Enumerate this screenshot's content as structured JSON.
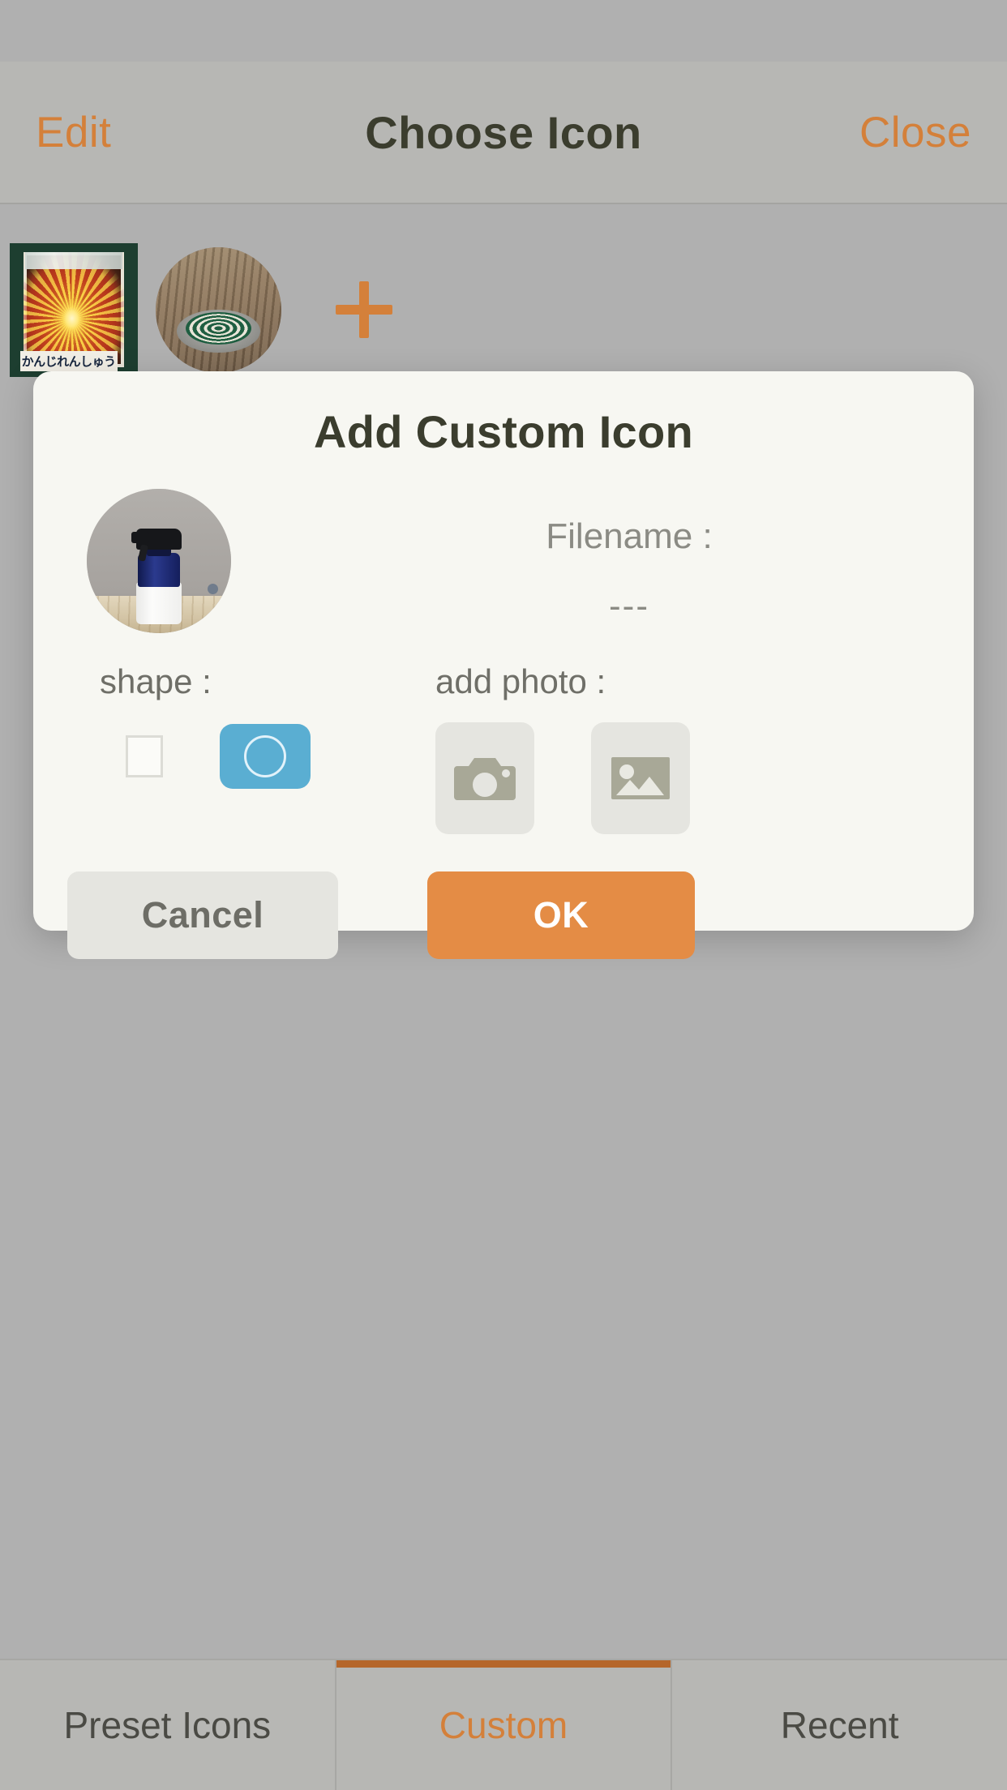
{
  "header": {
    "left_button": "Edit",
    "title": "Choose Icon",
    "right_button": "Close"
  },
  "thumbnails": {
    "items": [
      {
        "name": "seed-packet-thumbnail",
        "shape": "square",
        "caption": "かんじれんしゅう"
      },
      {
        "name": "mosquito-coil-thumbnail",
        "shape": "circle",
        "caption": ""
      }
    ],
    "add_button_label": "+"
  },
  "dialog": {
    "title": "Add Custom Icon",
    "filename_label": "Filename :",
    "filename_value": "---",
    "shape": {
      "label": "shape :",
      "options": [
        {
          "id": "square",
          "glyph": "square",
          "selected": false
        },
        {
          "id": "circle",
          "glyph": "circle",
          "selected": true
        }
      ],
      "selected_color": "#5AAED2"
    },
    "add_photo": {
      "label": "add photo :",
      "options": [
        {
          "id": "camera",
          "icon": "camera-icon"
        },
        {
          "id": "gallery",
          "icon": "image-icon"
        }
      ]
    },
    "buttons": {
      "cancel": "Cancel",
      "ok": "OK"
    }
  },
  "tabbar": {
    "tabs": [
      {
        "label": "Preset Icons",
        "active": false
      },
      {
        "label": "Custom",
        "active": true
      },
      {
        "label": "Recent",
        "active": false
      }
    ],
    "active_color": "#D4803A"
  },
  "colors": {
    "accent": "#D4803A",
    "ok_button": "#E48C45",
    "dialog_bg": "#F7F7F2",
    "app_bg": "#B0B0B0",
    "navbar_bg": "#B7B7B4",
    "text_dark": "#3B3D2E",
    "text_muted": "#8B8B84"
  }
}
